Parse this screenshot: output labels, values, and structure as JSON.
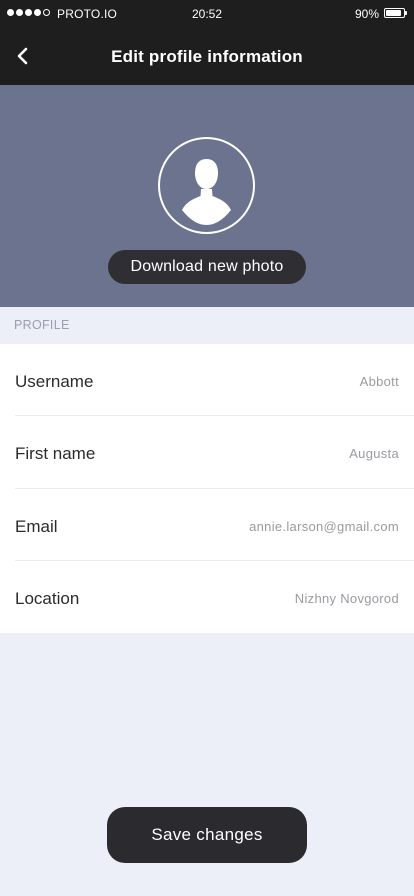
{
  "status_bar": {
    "carrier": "PROTO.IO",
    "time": "20:52",
    "battery": "90%",
    "signal_bars": 4,
    "signal_total": 5,
    "battery_level": 0.9
  },
  "navbar": {
    "title": "Edit profile information",
    "back_icon": "chevron-left-icon"
  },
  "hero": {
    "avatar_icon": "user-silhouette-icon",
    "photo_button_label": "Download new photo",
    "background_color": "#6c738f"
  },
  "profile": {
    "section_title": "PROFILE",
    "fields": [
      {
        "label": "Username",
        "value": "Abbott"
      },
      {
        "label": "First name",
        "value": "Augusta"
      },
      {
        "label": "Email",
        "value": "annie.larson@gmail.com"
      },
      {
        "label": "Location",
        "value": "Nizhny Novgorod"
      }
    ]
  },
  "footer": {
    "save_label": "Save changes"
  }
}
